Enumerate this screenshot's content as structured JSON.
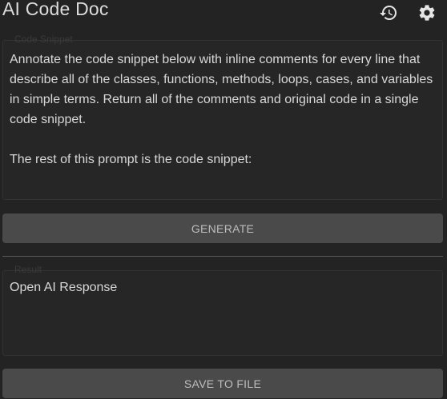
{
  "app": {
    "title": "AI Code Doc",
    "history_icon": "history-icon",
    "settings_icon": "gear-icon"
  },
  "code_snippet": {
    "legend": "Code Snippet",
    "value": "Annotate the code snippet below with inline comments for every line that describe all of the classes, functions, methods, loops, cases, and variables in simple terms. Return all of the comments and original code in a single code snippet.\n\nThe rest of this prompt is the code snippet:"
  },
  "actions": {
    "generate_label": "GENERATE",
    "save_label": "SAVE TO FILE"
  },
  "result": {
    "legend": "Result",
    "value": "Open AI Response"
  },
  "colors": {
    "background": "#232323",
    "button": "#4a4a4a",
    "text": "#d8d8d8"
  }
}
